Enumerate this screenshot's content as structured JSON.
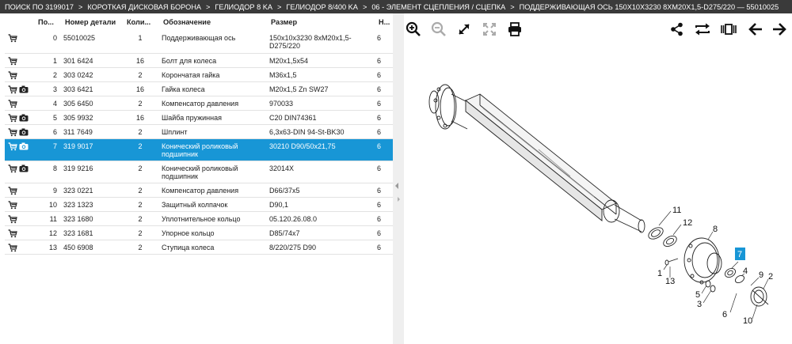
{
  "breadcrumb": [
    "ПОИСК ПО 3199017",
    "КОРОТКАЯ ДИСКОВАЯ БОРОНА",
    "ГЕЛИОДОР 8 KA",
    "ГЕЛИОДОР 8/400 KA",
    "06 - ЭЛЕМЕНТ СЦЕПЛЕНИЯ / СЦЕПКА",
    "ПОДДЕРЖИВАЮЩАЯ ОСЬ 150X10X3230 8XM20X1,5-D275/220 — 55010025"
  ],
  "breadcrumb_separator": ">",
  "table": {
    "headers": {
      "pos": "По...",
      "number": "Номер детали",
      "qty": "Коли...",
      "name": "Обозначение",
      "size": "Размер",
      "unit": "Н..."
    },
    "rows": [
      {
        "pos": "0",
        "number": "55010025",
        "qty": "1",
        "name": "Поддерживающая ось",
        "size": "150x10x3230 8xM20x1,5-D275/220",
        "unit": "6",
        "camera": false
      },
      {
        "pos": "1",
        "number": "301 6424",
        "qty": "16",
        "name": "Болт для колеса",
        "size": "M20x1,5x54",
        "unit": "6",
        "camera": false
      },
      {
        "pos": "2",
        "number": "303 0242",
        "qty": "2",
        "name": "Корончатая гайка",
        "size": "M36x1,5",
        "unit": "6",
        "camera": false
      },
      {
        "pos": "3",
        "number": "303 6421",
        "qty": "16",
        "name": "Гайка колеса",
        "size": "M20x1,5 Zn SW27",
        "unit": "6",
        "camera": true
      },
      {
        "pos": "4",
        "number": "305 6450",
        "qty": "2",
        "name": "Компенсатор давления",
        "size": "970033",
        "unit": "6",
        "camera": false
      },
      {
        "pos": "5",
        "number": "305 9932",
        "qty": "16",
        "name": "Шайба пружинная",
        "size": "C20 DIN74361",
        "unit": "6",
        "camera": true
      },
      {
        "pos": "6",
        "number": "311 7649",
        "qty": "2",
        "name": "Шплинт",
        "size": "6,3x63-DIN 94-St-BK30",
        "unit": "6",
        "camera": true
      },
      {
        "pos": "7",
        "number": "319 9017",
        "qty": "2",
        "name": "Конический роликовый подшипник",
        "size": "30210 D90/50x21,75",
        "unit": "6",
        "camera": true,
        "selected": true
      },
      {
        "pos": "8",
        "number": "319 9216",
        "qty": "2",
        "name": "Конический роликовый подшипник",
        "size": "32014X",
        "unit": "6",
        "camera": true
      },
      {
        "pos": "9",
        "number": "323 0221",
        "qty": "2",
        "name": "Компенсатор давления",
        "size": "D66/37x5",
        "unit": "6",
        "camera": false
      },
      {
        "pos": "10",
        "number": "323 1323",
        "qty": "2",
        "name": "Защитный колпачок",
        "size": "D90,1",
        "unit": "6",
        "camera": false
      },
      {
        "pos": "11",
        "number": "323 1680",
        "qty": "2",
        "name": "Уплотнительное кольцо",
        "size": "05.120.26.08.0",
        "unit": "6",
        "camera": false
      },
      {
        "pos": "12",
        "number": "323 1681",
        "qty": "2",
        "name": "Упорное кольцо",
        "size": "D85/74x7",
        "unit": "6",
        "camera": false
      },
      {
        "pos": "13",
        "number": "450 6908",
        "qty": "2",
        "name": "Ступица колеса",
        "size": "8/220/275 D90",
        "unit": "6",
        "camera": false
      }
    ]
  },
  "toolbar": {
    "left": [
      "zoom-in-icon",
      "zoom-out-icon",
      "expand-icon",
      "fullscreen-icon",
      "print-icon"
    ],
    "right": [
      "share-icon",
      "swap-icon",
      "compare-icon",
      "arrow-left-icon",
      "arrow-right-icon"
    ]
  },
  "diagram": {
    "callouts": [
      "11",
      "12",
      "8",
      "7",
      "4",
      "9",
      "2",
      "1",
      "13",
      "5",
      "3",
      "6",
      "10"
    ],
    "highlighted_callout": "7",
    "highlight_color": "#1896d6"
  },
  "colors": {
    "header_bg": "#3a3a3a",
    "selected_row": "#1896d6"
  }
}
